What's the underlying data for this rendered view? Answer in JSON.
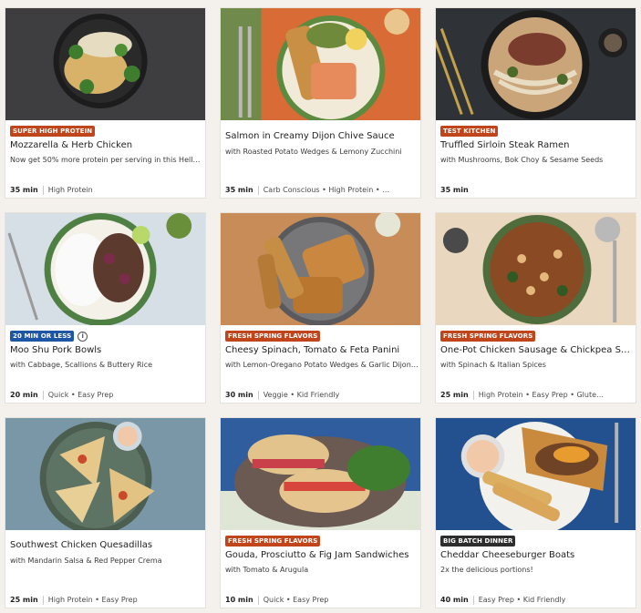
{
  "colors": {
    "badge_orange": "#c0451b",
    "badge_blue": "#1e56a6",
    "badge_dark": "#2d2d2d"
  },
  "recipes": [
    {
      "badge": "SUPER HIGH PROTEIN",
      "badge_color": "#c0451b",
      "title": "Mozzarella & Herb Chicken",
      "subtitle": "Now get 50% more protein per serving in this HelloF…",
      "time": "35 min",
      "tags": "High Protein"
    },
    {
      "badge": "",
      "badge_color": "",
      "title": "Salmon in Creamy Dijon Chive Sauce",
      "subtitle": "with Roasted Potato Wedges & Lemony Zucchini",
      "time": "35 min",
      "tags": "Carb Conscious • High Protein • …"
    },
    {
      "badge": "TEST KITCHEN",
      "badge_color": "#c0451b",
      "title": "Truffled Sirloin Steak Ramen",
      "subtitle": "with Mushrooms, Bok Choy & Sesame Seeds",
      "time": "35 min",
      "tags": ""
    },
    {
      "badge": "20 MIN OR LESS",
      "badge_color": "#1e56a6",
      "title": "Moo Shu Pork Bowls",
      "subtitle": "with Cabbage, Scallions & Buttery Rice",
      "time": "20 min",
      "tags": "Quick • Easy Prep",
      "info": "i"
    },
    {
      "badge": "FRESH SPRING FLAVORS",
      "badge_color": "#c0451b",
      "title": "Cheesy Spinach, Tomato & Feta Panini",
      "subtitle": "with Lemon-Oregano Potato Wedges & Garlic Dijon…",
      "time": "30 min",
      "tags": "Veggie • Kid Friendly"
    },
    {
      "badge": "FRESH SPRING FLAVORS",
      "badge_color": "#c0451b",
      "title": "One-Pot Chicken Sausage & Chickpea S…",
      "subtitle": "with Spinach & Italian Spices",
      "time": "25 min",
      "tags": "High Protein • Easy Prep • Glute…"
    },
    {
      "badge": "",
      "badge_color": "",
      "title": "Southwest Chicken Quesadillas",
      "subtitle": "with Mandarin Salsa & Red Pepper Crema",
      "time": "25 min",
      "tags": "High Protein • Easy Prep"
    },
    {
      "badge": "FRESH SPRING FLAVORS",
      "badge_color": "#c0451b",
      "title": "Gouda, Prosciutto & Fig Jam Sandwiches",
      "subtitle": "with Tomato & Arugula",
      "time": "10 min",
      "tags": "Quick • Easy Prep"
    },
    {
      "badge": "BIG BATCH DINNER",
      "badge_color": "#2d2d2d",
      "title": "Cheddar Cheeseburger Boats",
      "subtitle": "2x the delicious portions!",
      "time": "40 min",
      "tags": "Easy Prep • Kid Friendly"
    }
  ]
}
